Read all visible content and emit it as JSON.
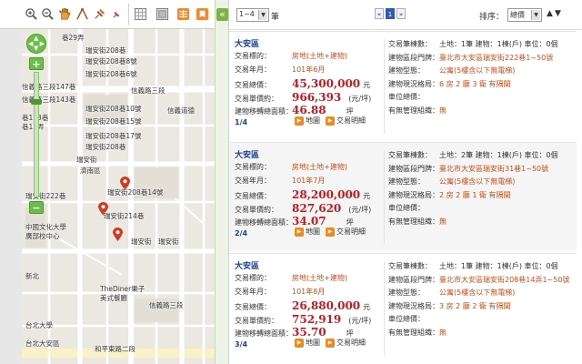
{
  "toolbar": {
    "tools": [
      {
        "name": "zoom-in-tool-icon"
      },
      {
        "name": "zoom-out-tool-icon"
      },
      {
        "name": "pan-hand-tool-icon"
      },
      {
        "name": "measure-distance-tool-icon"
      },
      {
        "name": "push-pin-tool-icon"
      },
      {
        "name": "grid-map-tool-icon"
      },
      {
        "name": "satellite-tool-icon"
      },
      {
        "name": "layers-tool-icon"
      },
      {
        "name": "bookmark-tool-icon"
      }
    ],
    "collapse_glyph": "«"
  },
  "map": {
    "zoom_in": "+",
    "zoom_out": "−",
    "zoom_level_fraction": 0.22,
    "street_labels": [
      "巷29弄",
      "瑞安街208巷",
      "瑞安街208巷8號",
      "瑞安街208巷6號",
      "信義路三段147巷",
      "信義路三段143巷",
      "瑞安街208巷10號",
      "信義路三段",
      "瑞安街208巷15號",
      "瑞安街208巷17號",
      "巷12弄",
      "瑞安街208巷",
      "巷123巷",
      "瑞安街",
      "濟南區",
      "中國文化大學",
      "廣部校中心",
      "瑞安街208巷14號",
      "瑞安街214巷",
      "瑞安街",
      "瑞安街222巷",
      "新北",
      "信義路三段",
      "TheDiner樂子",
      "美式餐廳",
      "台北大學",
      "和平東路二段",
      "台北大安區",
      "信義道德",
      "瑞安街"
    ]
  },
  "list": {
    "range_select": "1~4",
    "range_unit": "筆",
    "pager": [
      "«",
      "1",
      "»"
    ],
    "pager_active_index": 1,
    "sort_label": "排序：",
    "sort_select": "總價",
    "sort_up": "▲",
    "sort_down": "▼",
    "labels": {
      "type": "交易標的：",
      "date": "交易年月：",
      "total": "交易總價：",
      "unit_price": "交易單價約：",
      "area": "建物移轉總面積：",
      "count": "交易筆棟數：",
      "address": "建物區段門牌：",
      "building_type": "建物型態：",
      "layout": "建物現況格局：",
      "parking": "車位總價：",
      "management": "有無管理組織：",
      "unit_price_unit": "(元/坪)",
      "total_unit": "元",
      "area_unit": "坪",
      "map_button": "地圖",
      "detail_button": "交易明細"
    },
    "records": [
      {
        "district": "大安區",
        "type": "房地(土地+建物)",
        "date": "101年6月",
        "total": "45,300,000",
        "unit_price": "966,393",
        "area": "46.88",
        "index": "1/4",
        "count": "土地：1筆 建物：1棟(戶) 車位：0個",
        "address": "臺北市大安區瑞安街222巷1~50號",
        "building_type": "公寓(5樓含以下無電梯)",
        "layout": "6 房 2 廳 3 衛 有隔間",
        "parking": "",
        "management": "無"
      },
      {
        "district": "大安區",
        "type": "房地(土地+建物)",
        "date": "101年7月",
        "total": "28,200,000",
        "unit_price": "827,620",
        "area": "34.07",
        "index": "2/4",
        "count": "土地：2筆 建物：1棟(戶) 車位：0個",
        "address": "臺北市大安區瑞安街31巷1~50號",
        "building_type": "公寓(5樓含以下無電梯)",
        "layout": "2 房 2 廳 1 衛 有隔間",
        "parking": "",
        "management": "無"
      },
      {
        "district": "大安區",
        "type": "房地(土地+建物)",
        "date": "101年8月",
        "total": "26,880,000",
        "unit_price": "752,919",
        "area": "35.70",
        "index": "3/4",
        "count": "土地：1筆 建物：1棟(戶) 車位：0個",
        "address": "臺北市大安區瑞安街208巷14弄1~50號",
        "building_type": "公寓(5樓含以下無電梯)",
        "layout": "3 房 2 廳 2 衛 有隔間",
        "parking": "",
        "management": "無"
      }
    ]
  },
  "colors": {
    "accent_green": "#6bbe4a",
    "price_red": "#c6191f",
    "value_orange": "#c0521b",
    "district_blue": "#1a3f9a"
  }
}
